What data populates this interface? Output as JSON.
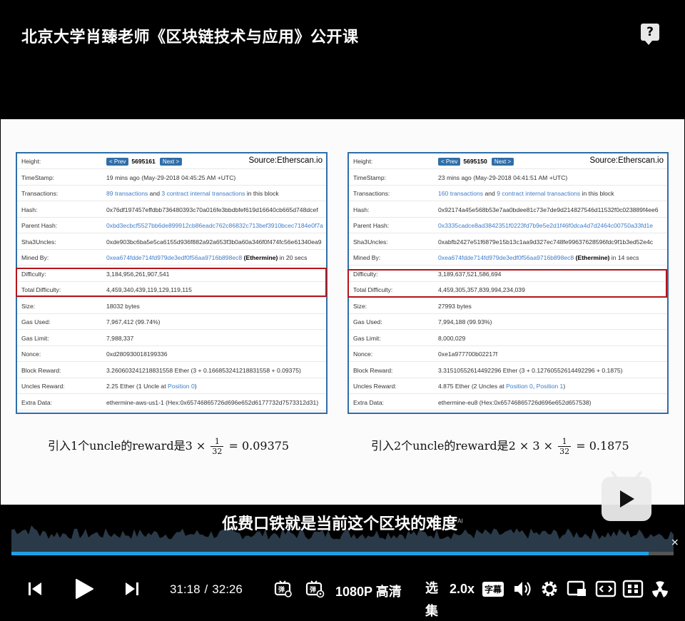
{
  "header": {
    "title": "北京大学肖臻老师《区块链技术与应用》公开课",
    "help_icon": "question-bubble-icon"
  },
  "slide": {
    "left_panel": {
      "source": "Source:Etherscan.io",
      "prev_label": "< Prev",
      "next_label": "Next >",
      "height_value": "5695161",
      "rows": [
        {
          "key": "Height:",
          "value": ""
        },
        {
          "key": "TimeStamp:",
          "value": "19 mins ago (May-29-2018 04:45:25 AM +UTC)"
        },
        {
          "key": "Transactions:",
          "link1": "89 transactions",
          "mid": " and ",
          "link2": "3 contract internal transactions",
          "tail": " in this block"
        },
        {
          "key": "Hash:",
          "value": "0x76df197457effdbb736480393c70a016fe3bbdbfef619d16640cb665d748dcef"
        },
        {
          "key": "Parent Hash:",
          "link": "0xbd3ecbcf5527bb6de899912cb86eadc762c86832c713bef3910bcec7184e0f7a"
        },
        {
          "key": "Sha3Uncles:",
          "value": "0xde903bc6ba5e5ca6155d936f882a92a653f3b0a60a346f0f474fc56e61340ea9"
        },
        {
          "key": "Mined By:",
          "link": "0xea674fdde714fd979de3edf0f56aa9716b898ec8",
          "bold": " (Ethermine)",
          "tail": " in 20 secs"
        },
        {
          "key": "Difficulty:",
          "value": "3,184,956,261,907,541"
        },
        {
          "key": "Total Difficulty:",
          "value": "4,459,340,439,119,129,119,115"
        },
        {
          "key": "Size:",
          "value": "18032 bytes"
        },
        {
          "key": "Gas Used:",
          "value": "7,967,412 (99.74%)"
        },
        {
          "key": "Gas Limit:",
          "value": "7,988,337"
        },
        {
          "key": "Nonce:",
          "value": "0xd280930018199336"
        },
        {
          "key": "Block Reward:",
          "value": "3.260603241218831558 Ether (3 + 0.166853241218831558 + 0.09375)"
        },
        {
          "key": "Uncles Reward:",
          "pre": "2.25 Ether (1 Uncle at ",
          "link": "Position 0",
          "tail": ")"
        },
        {
          "key": "Extra Data:",
          "value": "ethermine-aws-us1-1 (Hex:0x65746865726d696e652d6177732d7573312d31)"
        }
      ]
    },
    "right_panel": {
      "source": "Source:Etherscan.io",
      "prev_label": "< Prev",
      "next_label": "Next >",
      "height_value": "5695150",
      "rows": [
        {
          "key": "Height:",
          "value": ""
        },
        {
          "key": "TimeStamp:",
          "value": "23 mins ago (May-29-2018 04:41:51 AM +UTC)"
        },
        {
          "key": "Transactions:",
          "link1": "160 transactions",
          "mid": " and ",
          "link2": "9 contract internal transactions",
          "tail": " in this block"
        },
        {
          "key": "Hash:",
          "value": "0x92174a45e568b53e7aa0bdee81c73e7de9d214827546d11532f0c023889f4ee6"
        },
        {
          "key": "Parent Hash:",
          "link": "0x3335cadce8ad3842351f0223fd7b9e5e2d1f46f0dca4d7d2464c00750a33fd1e"
        },
        {
          "key": "Sha3Uncles:",
          "value": "0xabfb2427e51f6879e15b13c1aa9d327ec748fe99637628596fdc9f1b3ed52e4c"
        },
        {
          "key": "Mined By:",
          "link": "0xea674fdde714fd979de3edf0f56aa9716b898ec8",
          "bold": " (Ethermine)",
          "tail": " in 14 secs"
        },
        {
          "key": "Difficulty:",
          "value": "3,189,637,521,586,694"
        },
        {
          "key": "Total Difficulty:",
          "value": "4,459,305,357,839,994,234,039"
        },
        {
          "key": "Size:",
          "value": "27993 bytes"
        },
        {
          "key": "Gas Used:",
          "value": "7,994,188 (99.93%)"
        },
        {
          "key": "Gas Limit:",
          "value": "8,000,029"
        },
        {
          "key": "Nonce:",
          "value": "0xe1a977700b02217f"
        },
        {
          "key": "Block Reward:",
          "value": "3.31510552614492296 Ether (3 + 0.12760552614492296 + 0.1875)"
        },
        {
          "key": "Uncles Reward:",
          "pre": "4.875 Ether (2 Uncles at ",
          "link": "Position 0",
          "mid": ", ",
          "link2": "Position 1",
          "tail": ")"
        },
        {
          "key": "Extra Data:",
          "value": "ethermine-eu8 (Hex:0x65746865726d696e652d657538)"
        }
      ]
    },
    "formula_left": {
      "prefix": "引入1个uncle的reward是3 ×",
      "num": "1",
      "den": "32",
      "suffix": "= 0.09375"
    },
    "formula_right": {
      "prefix": "引入2个uncle的reward是2 × 3 ×",
      "num": "1",
      "den": "32",
      "suffix": "= 0.1875"
    }
  },
  "subtitle": {
    "text": "低费口铁就是当前这个区块的难度",
    "ai_tag": "AI"
  },
  "player": {
    "progress": 0.962,
    "current_time": "31:18",
    "separator": "/",
    "duration": "32:26",
    "quality": "1080P 高清",
    "select": "选集",
    "speed": "2.0x",
    "subtitle_btn": "字幕",
    "icons": [
      "prev-icon",
      "play-icon",
      "next-icon",
      "danmaku-toggle-icon",
      "danmaku-settings-icon",
      "volume-icon",
      "settings-icon",
      "pip-icon",
      "widescreen-icon",
      "fullscreen-icon",
      "radiation-icon",
      "bilibili-tv-icon"
    ],
    "colors": {
      "progress": "#1fa0e6",
      "highlight": "#b3141a",
      "panel_border": "#2f6ea8"
    }
  }
}
